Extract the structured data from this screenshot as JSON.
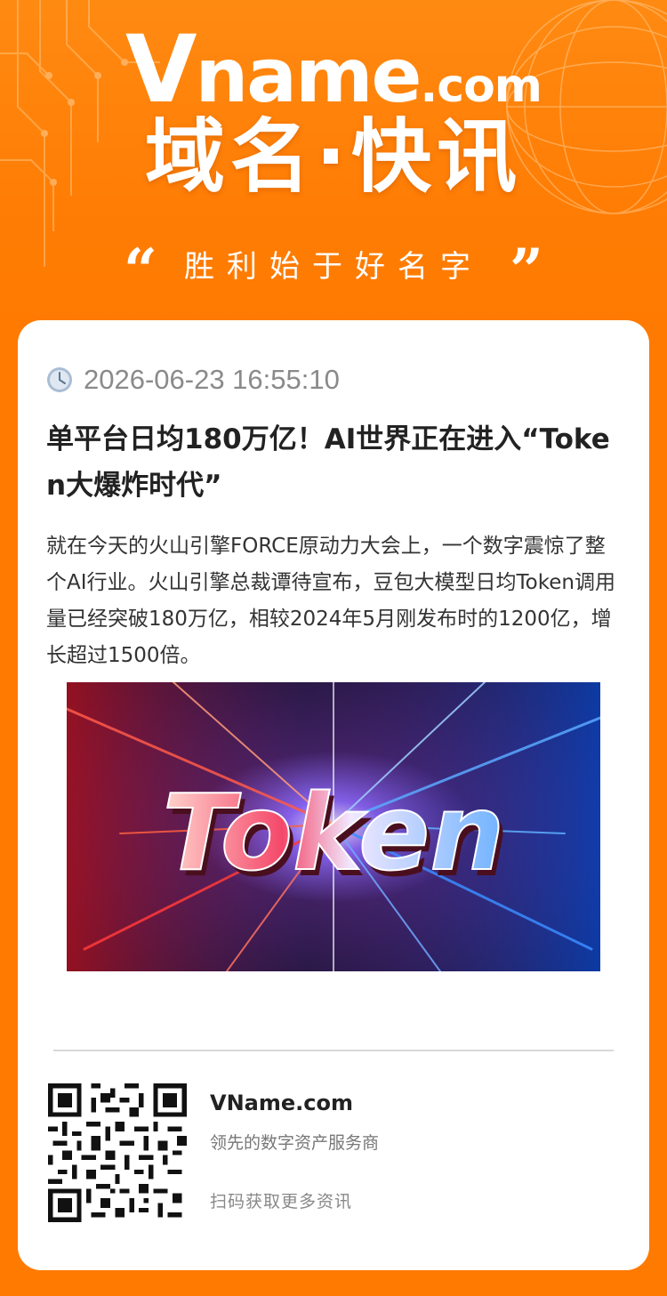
{
  "header": {
    "logo_v": "V",
    "logo_name": "name",
    "logo_dotcom": ".com",
    "headline": "域名·快讯",
    "quote_open": "“",
    "slogan": "胜利始于好名字",
    "quote_close": "”"
  },
  "article": {
    "date": "2026-06-23 16:55:10",
    "title": "单平台日均180万亿！AI世界正在进入“Token大爆炸时代”",
    "body": "就在今天的火山引擎FORCE原动力大会上，一个数字震惊了整个AI行业。火山引擎总裁谭待宣布，豆包大模型日均Token调用量已经突破180万亿，相较2024年5月刚发布时的1200亿，增长超过1500倍。",
    "hero_text": "Token"
  },
  "footer": {
    "brand": "VName.com",
    "tagline": "领先的数字资产服务商",
    "scan_hint": "扫码获取更多资讯"
  },
  "colors": {
    "brand_orange": "#ff7a00",
    "card_bg": "#ffffff",
    "title_text": "#222222",
    "muted_text": "#8a8a8a"
  },
  "icons": {
    "date": "clock-icon",
    "footer": "qr-code"
  }
}
